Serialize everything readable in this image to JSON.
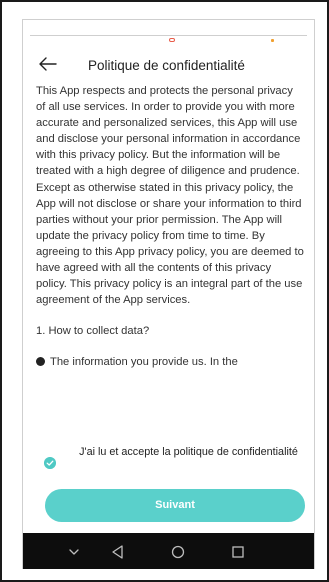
{
  "screen": {
    "title": "Politique de confidentialité"
  },
  "policy": {
    "paragraph": "This App respects and protects the personal privacy of all use services. In order to provide you with more accurate and personalized services, this App will use and disclose your personal information in accordance with this privacy policy. But the information will be treated with a high degree of diligence and prudence. Except as otherwise stated in this privacy policy, the App will not disclose or share your information to third parties without your prior permission. The App will update the privacy policy from time to time. By agreeing to this App privacy policy, you are deemed to have agreed with all the contents of this privacy policy. This privacy policy is an integral part of the use agreement of the App services.",
    "section_heading": "1. How to collect data?",
    "bullet_text": "The information you provide us. In the"
  },
  "consent": {
    "label": "J'ai lu et accepte la politique de confidentialité",
    "checked": true
  },
  "actions": {
    "next_label": "Suivant"
  },
  "icons": {
    "back": "arrow-left-icon",
    "check": "check-circle-icon",
    "nav_menu": "chevron-down-icon",
    "nav_back": "triangle-back-icon",
    "nav_home": "circle-home-icon",
    "nav_recents": "square-recents-icon"
  },
  "colors": {
    "accent": "#5ad0cb",
    "check": "#4fc9c4",
    "nav_bar": "#0d0d0d",
    "text": "#333333"
  }
}
